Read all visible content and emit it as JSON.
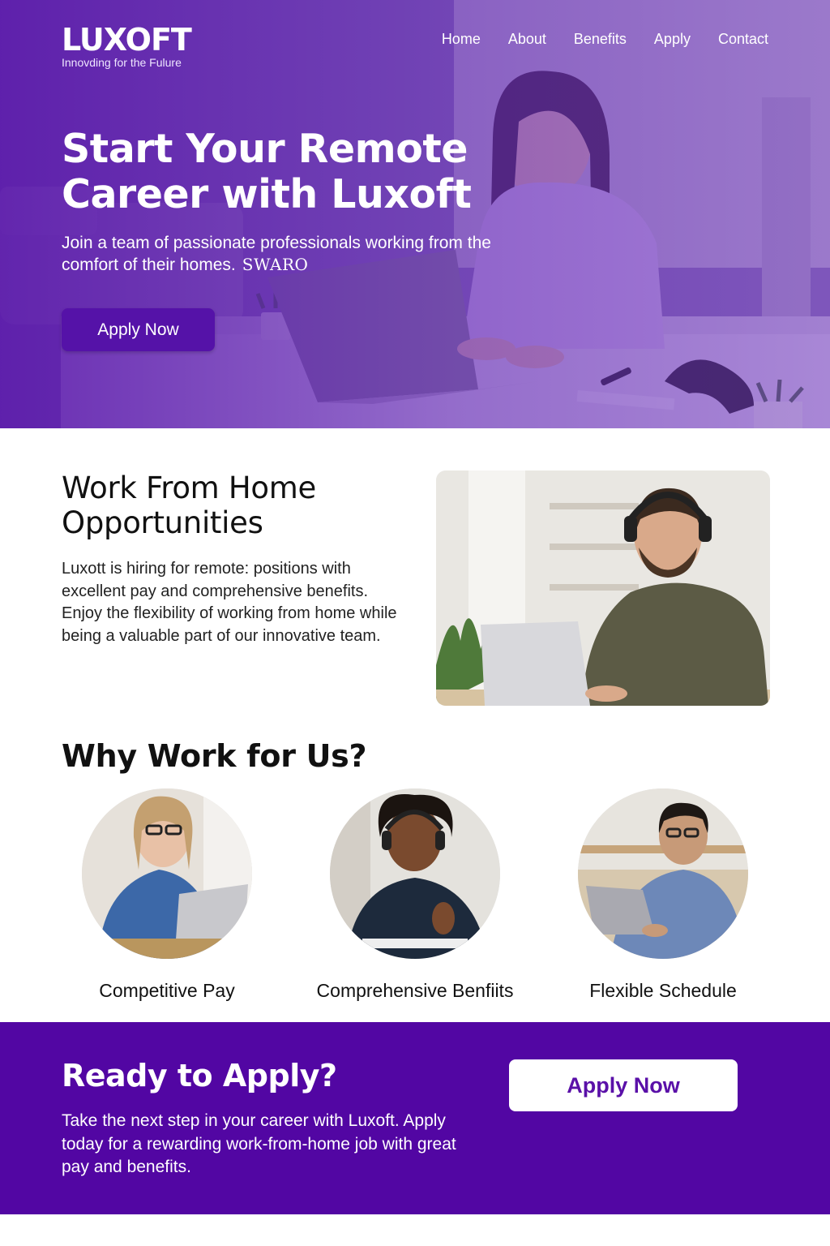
{
  "brand": {
    "name": "LUXOFT",
    "tagline": "Innovding for the Fulure"
  },
  "nav": {
    "items": [
      "Home",
      "About",
      "Benefits",
      "Apply",
      "Contact"
    ]
  },
  "hero": {
    "title": "Start Your Remote Career with Luxoft",
    "subtitle": "Join a team of passionate professionals working from the comfort of their homes.",
    "signature": "SWARO",
    "button_label": "Apply Now"
  },
  "opportunities": {
    "title": "Work From Home Opportunities",
    "body": "Luxott is hiring for remote: positions with excellent pay and comprehensive benefits. Enjoy the flexibility of working from home while being a valuable part of our innovative team."
  },
  "why": {
    "title": "Why Work for Us?",
    "features": [
      {
        "label": "Competitive Pay"
      },
      {
        "label": "Comprehensive Benfiits"
      },
      {
        "label": "Flexible Schedule"
      }
    ]
  },
  "cta": {
    "title": "Ready to Apply?",
    "body": "Take the next step in your career with Luxoft. Apply today for a rewarding work-from-home job with great pay and benefits.",
    "button_label": "Apply Now"
  },
  "colors": {
    "brand_purple": "#5206a3",
    "button_purple": "#5512a8",
    "cta_text_purple": "#5a10a8"
  },
  "icons": [
    "hero-photo",
    "man-with-headset-photo",
    "woman-with-glasses-photo",
    "woman-with-headset-photo",
    "man-on-couch-photo"
  ]
}
